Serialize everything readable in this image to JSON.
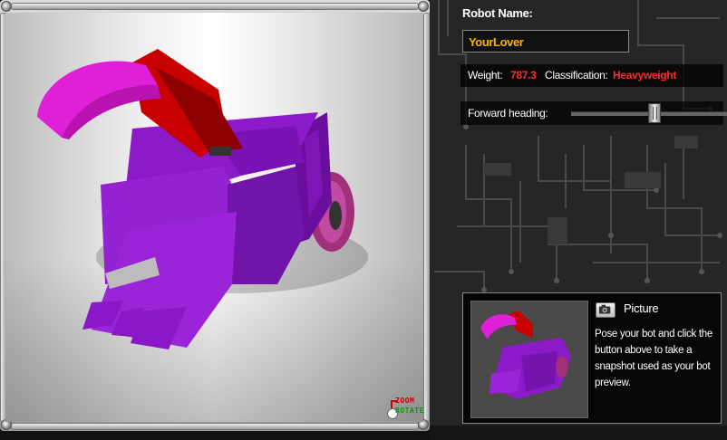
{
  "viewport": {
    "controls": {
      "zoom_label": "ZOOM",
      "rotate_label": "ROTATE"
    }
  },
  "robot": {
    "name_label": "Robot Name:",
    "name_value": "YourLover",
    "weight_label": "Weight:",
    "weight_value": "787.3",
    "classification_label": "Classification:",
    "classification_value": "Heavyweight",
    "heading_label": "Forward heading:",
    "heading_slider_fraction": 0.52
  },
  "picture": {
    "title": "Picture",
    "camera_icon": "camera-icon",
    "description": "Pose your bot and click the button above to take a snapshot used as your bot preview."
  },
  "colors": {
    "robot_body": "#8a18c8",
    "robot_weapon": "#e020d8",
    "robot_plate": "#c80000",
    "name_text": "#f4b400",
    "stat_highlight": "#ff2a2a",
    "zoom_label": "#d00000",
    "rotate_label": "#00a000"
  }
}
